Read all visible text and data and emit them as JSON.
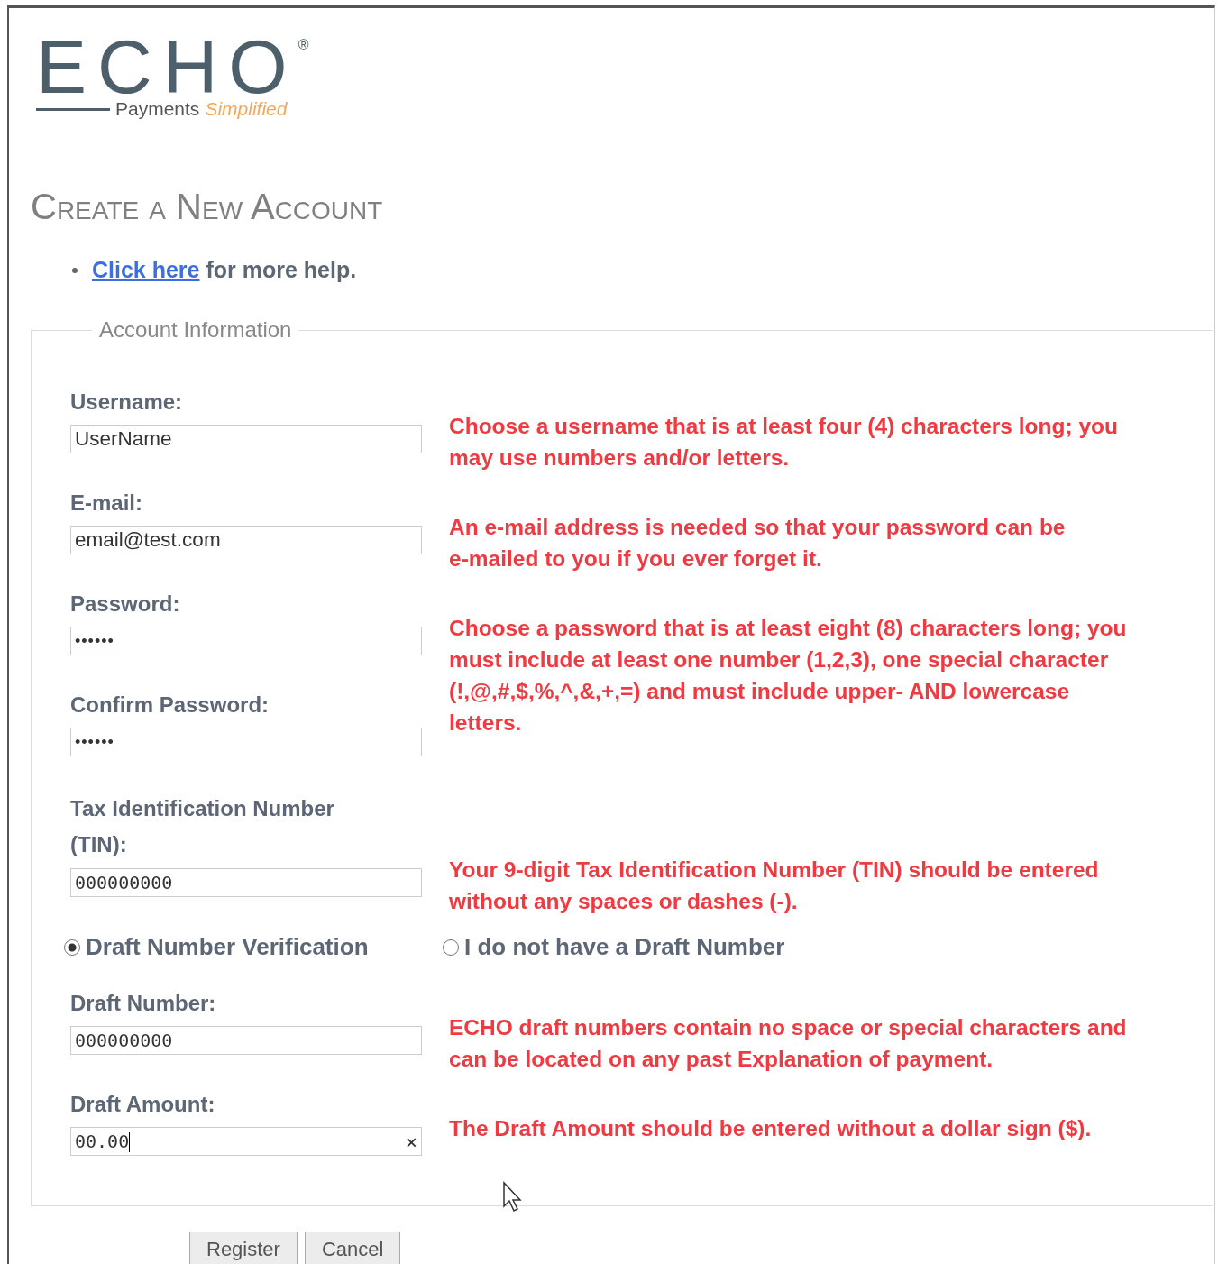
{
  "logo": {
    "wordmark": "ECHO",
    "registered": "®",
    "tagline": "Payments",
    "tagline_accent": "Simplified"
  },
  "heading": "Create a New Account",
  "help": {
    "link": "Click here",
    "text": "for more help."
  },
  "fieldset": {
    "legend": "Account Information"
  },
  "groups": [
    {
      "fields": [
        {
          "label": "Username:",
          "value": "UserName",
          "kind": "text"
        }
      ],
      "hint": "Choose a username that is at least four (4) characters long; you\nmay use numbers and/or letters."
    },
    {
      "fields": [
        {
          "label": "E-mail:",
          "value": "email@test.com",
          "kind": "text"
        }
      ],
      "hint": "An e-mail address is needed so that your password can be\ne-mailed to you if you ever forget it."
    },
    {
      "fields": [
        {
          "label": "Password:",
          "value": "••••••",
          "kind": "password"
        },
        {
          "label": "Confirm Password:",
          "value": "••••••",
          "kind": "password"
        }
      ],
      "hint": "Choose a password that is at least eight (8) characters long; you\nmust include at least one number (1,2,3), one special character\n(!,@,#,$,%,^,&,+,=) and must include upper- AND lowercase\nletters."
    },
    {
      "fields": [
        {
          "label": "Tax Identification Number (TIN):",
          "value": "000000000",
          "kind": "mono"
        }
      ],
      "hint": "Your 9-digit Tax Identification Number (TIN) should be entered\nwithout any spaces or dashes (-)."
    }
  ],
  "radios": [
    {
      "label": "Draft Number Verification",
      "selected": true
    },
    {
      "label": "I do not have a Draft Number",
      "selected": false
    }
  ],
  "draft_groups": [
    {
      "fields": [
        {
          "label": "Draft Number:",
          "value": "000000000",
          "kind": "mono"
        }
      ],
      "hint": "ECHO draft numbers contain no space or special characters and\ncan be located on any past Explanation of payment."
    },
    {
      "fields": [
        {
          "label": "Draft Amount:",
          "value": "00.00",
          "kind": "mono",
          "clear": "×",
          "focused": true
        }
      ],
      "hint": "The Draft Amount should be entered without a dollar sign ($)."
    }
  ],
  "buttons": [
    "Register",
    "Cancel"
  ]
}
